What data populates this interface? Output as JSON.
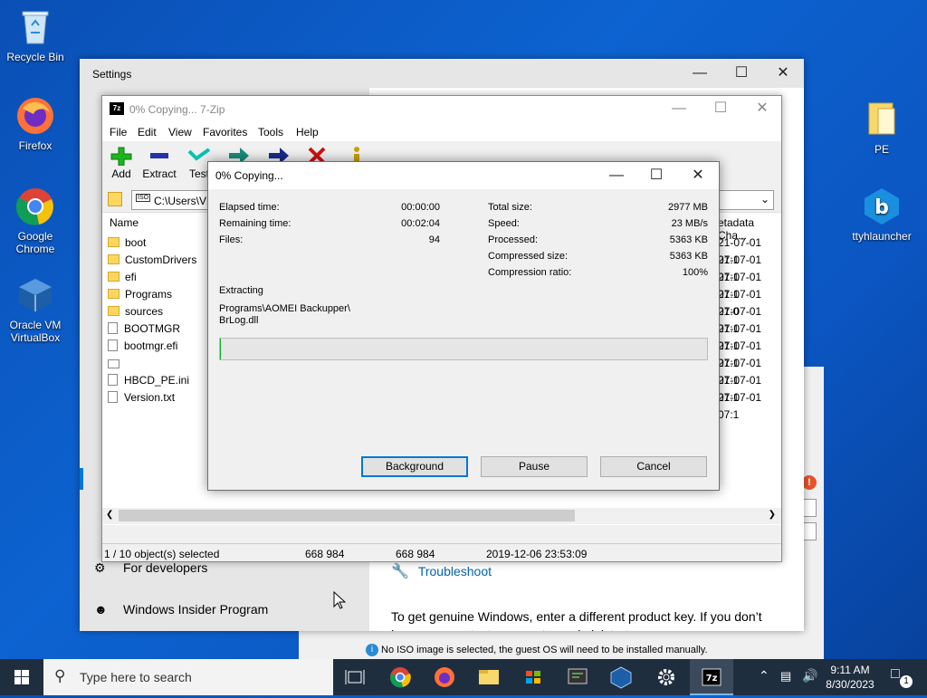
{
  "desktop": {
    "icons": [
      {
        "label": "Recycle Bin"
      },
      {
        "label": "Firefox"
      },
      {
        "label": "Google Chrome"
      },
      {
        "label": "Oracle VM VirtualBox"
      },
      {
        "label": "PE"
      },
      {
        "label": "ttyhlauncher"
      }
    ]
  },
  "settings": {
    "title": "Settings",
    "nav": {
      "for_developers": "For developers",
      "insider": "Windows Insider Program"
    },
    "troubleshoot": "Troubleshoot",
    "activation_text": "To get genuine Windows, enter a different product key. If you don’t have one, contact your system administrator.",
    "vbox_hint": "No ISO image is selected, the guest OS will need to be installed manually."
  },
  "zip": {
    "title": "0% Copying... 7-Zip",
    "menu": [
      "File",
      "Edit",
      "View",
      "Favorites",
      "Tools",
      "Help"
    ],
    "toolbar": [
      "Add",
      "Extract",
      "Test"
    ],
    "address": "C:\\Users\\VM",
    "columns": {
      "name": "Name",
      "meta": "etadata Cha..."
    },
    "files": [
      {
        "name": "boot",
        "type": "folder",
        "date": "21-07-01 07:1"
      },
      {
        "name": "CustomDrivers",
        "type": "folder",
        "date": "21-07-01 07:1"
      },
      {
        "name": "efi",
        "type": "folder",
        "date": "21-07-01 07:1"
      },
      {
        "name": "Programs",
        "type": "folder",
        "date": "21-07-01 07:0"
      },
      {
        "name": "sources",
        "type": "folder",
        "date": "21-07-01 07:1"
      },
      {
        "name": "BOOTMGR",
        "type": "file",
        "date": "21-07-01 07:1"
      },
      {
        "name": "bootmgr.efi",
        "type": "file",
        "date": "21-07-01 07:1"
      },
      {
        "name": "",
        "type": "file",
        "date": "21-07-01 07:1"
      },
      {
        "name": "HBCD_PE.ini",
        "type": "file",
        "date": "21-07-01 07:1"
      },
      {
        "name": "Version.txt",
        "type": "file",
        "date": "21-07-01 07:1"
      }
    ],
    "status": {
      "selected": "1 / 10 object(s) selected",
      "size1": "668 984",
      "size2": "668 984",
      "date": "2019-12-06 23:53:09"
    }
  },
  "dialog": {
    "title": "0% Copying...",
    "elapsed_label": "Elapsed time:",
    "elapsed": "00:00:00",
    "remaining_label": "Remaining time:",
    "remaining": "00:02:04",
    "files_label": "Files:",
    "files": "94",
    "total_label": "Total size:",
    "total": "2977 MB",
    "speed_label": "Speed:",
    "speed": "23 MB/s",
    "processed_label": "Processed:",
    "processed": "5363 KB",
    "compressed_label": "Compressed size:",
    "compressed": "5363 KB",
    "ratio_label": "Compression ratio:",
    "ratio": "100%",
    "action": "Extracting",
    "path1": "Programs\\AOMEI Backupper\\",
    "path2": "BrLog.dll",
    "progress": 0.0,
    "buttons": {
      "background": "Background",
      "pause": "Pause",
      "cancel": "Cancel"
    }
  },
  "taskbar": {
    "search_placeholder": "Type here to search",
    "time": "9:11 AM",
    "date": "8/30/2023",
    "notif_count": "1"
  },
  "colors": {
    "accent": "#0078d7",
    "taskbar": "#1f2e3f",
    "desktop": "#0d63d1"
  }
}
